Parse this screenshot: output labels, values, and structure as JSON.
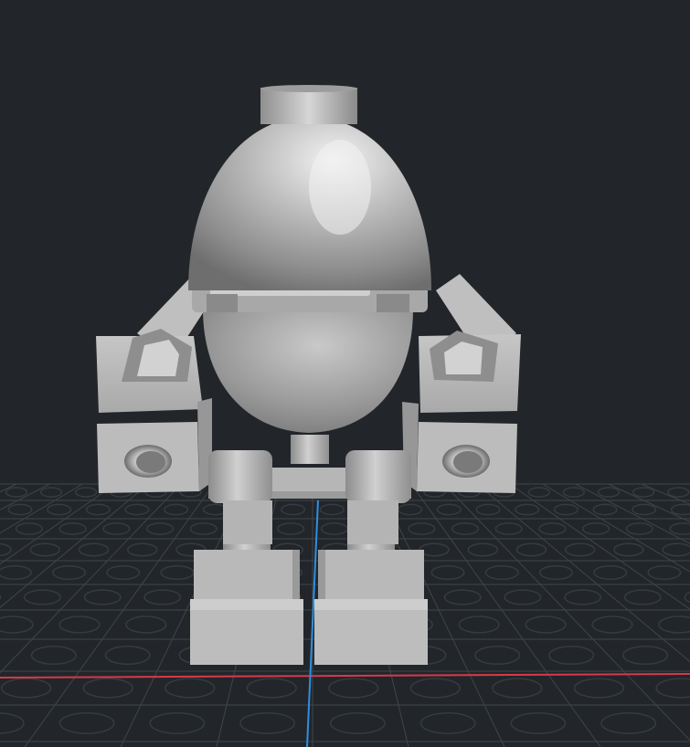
{
  "viewport": {
    "background_color": "#22262a",
    "grid_color": "#3f4549",
    "stud_ring_color": "#353b3f",
    "x_axis_color": "#d63a4a",
    "y_axis_color": "#2f8fe0"
  },
  "model": {
    "material_color": "#b8b8b8",
    "shadow_color": "#7a7a7a",
    "highlight_color": "#ededed"
  }
}
